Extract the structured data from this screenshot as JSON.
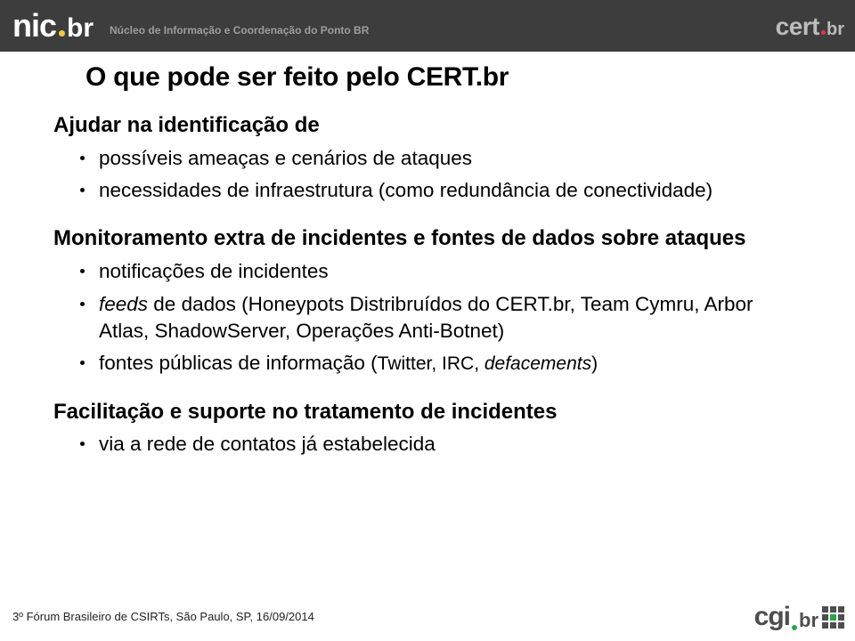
{
  "header": {
    "logo_main": "nic",
    "logo_br": "br",
    "subtitle": "Núcleo de Informação e Coordenação do Ponto BR",
    "cert_main": "cert",
    "cert_br": "br"
  },
  "title": "O que pode ser feito pelo CERT.br",
  "section1": {
    "head_l1": "Ajudar na identificação de",
    "b1": "possíveis ameaças e cenários de ataques",
    "b2": "necessidades de infraestrutura (como redundância de conectividade)"
  },
  "section2": {
    "head_l1": "Monitoramento extra de incidentes e fontes de dados sobre ataques",
    "b1": "notificações de incidentes",
    "b2_part1": "feeds",
    "b2_part2": " de dados (Honeypots Distribruídos do CERT.br, Team Cymru, Arbor Atlas, ShadowServer, Operações Anti-Botnet)",
    "b3_part1": "fontes públicas de informação (",
    "b3_part2": "Twitter, IRC, ",
    "b3_part3": "defacements",
    "b3_part4": ")"
  },
  "section3": {
    "head": "Facilitação e suporte no tratamento de incidentes",
    "b1": "via a rede de contatos já estabelecida"
  },
  "footer": {
    "note": "3º Fórum Brasileiro de CSIRTs, São Paulo, SP, 16/09/2014",
    "cgi_main": "cgi",
    "cgi_br": "br"
  }
}
